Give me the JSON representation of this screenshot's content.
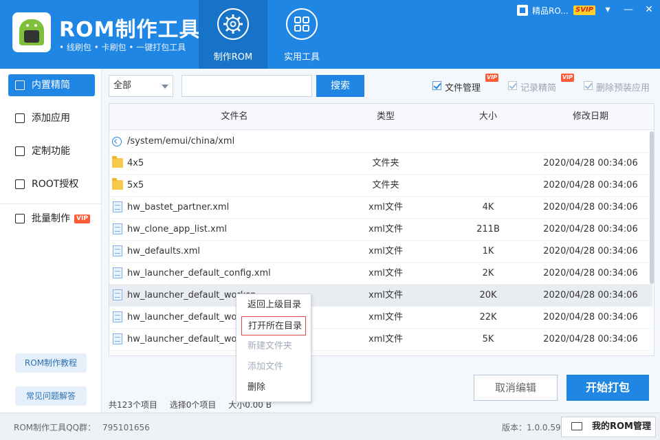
{
  "header": {
    "app_title": "ROM制作工具",
    "app_subtitle": "• 线刷包  • 卡刷包  • 一键打包工具",
    "tabs": [
      {
        "label": "制作ROM",
        "icon": "gear-icon",
        "active": true
      },
      {
        "label": "实用工具",
        "icon": "grid-icon",
        "active": false
      }
    ],
    "user_name": "精品RO...",
    "user_badge": "SVIP",
    "window_controls": {
      "dropdown": "▾",
      "minimize": "—",
      "close": "✕"
    }
  },
  "sidebar": {
    "items": [
      {
        "label": "内置精简",
        "icon": "export-icon",
        "active": true
      },
      {
        "label": "添加应用",
        "icon": "plus-box-icon",
        "active": false
      },
      {
        "label": "定制功能",
        "icon": "document-edit-icon",
        "active": false
      },
      {
        "label": "ROOT授权",
        "icon": "lock-icon",
        "active": false
      },
      {
        "label": "批量制作",
        "icon": "batch-icon",
        "active": false,
        "badge": "VIP"
      }
    ],
    "links": [
      "ROM制作教程",
      "常见问题解答"
    ]
  },
  "toolbar": {
    "filter_select": "全部",
    "search_value": "",
    "search_button": "搜索",
    "checkboxes": [
      {
        "label": "文件管理",
        "checked": true,
        "enabled": true,
        "vip": "VIP"
      },
      {
        "label": "记录精简",
        "checked": true,
        "enabled": false,
        "vip": "VIP"
      },
      {
        "label": "删除预装应用",
        "checked": true,
        "enabled": false
      }
    ]
  },
  "table": {
    "columns": [
      "文件名",
      "类型",
      "大小",
      "修改日期"
    ],
    "path": "/system/emui/china/xml",
    "rows": [
      {
        "name": "4x5",
        "type": "文件夹",
        "size": "",
        "date": "2020/04/28 00:34:06",
        "kind": "folder"
      },
      {
        "name": "5x5",
        "type": "文件夹",
        "size": "",
        "date": "2020/04/28 00:34:06",
        "kind": "folder"
      },
      {
        "name": "hw_bastet_partner.xml",
        "type": "xml文件",
        "size": "4K",
        "date": "2020/04/28 00:34:06",
        "kind": "file"
      },
      {
        "name": "hw_clone_app_list.xml",
        "type": "xml文件",
        "size": "211B",
        "date": "2020/04/28 00:34:06",
        "kind": "file"
      },
      {
        "name": "hw_defaults.xml",
        "type": "xml文件",
        "size": "1K",
        "date": "2020/04/28 00:34:06",
        "kind": "file"
      },
      {
        "name": "hw_launcher_default_config.xml",
        "type": "xml文件",
        "size": "2K",
        "date": "2020/04/28 00:34:06",
        "kind": "file"
      },
      {
        "name": "hw_launcher_default_worksp",
        "type": "xml文件",
        "size": "20K",
        "date": "2020/04/28 00:34:06",
        "kind": "file",
        "hover": true
      },
      {
        "name": "hw_launcher_default_worksp",
        "type": "xml文件",
        "size": "22K",
        "date": "2020/04/28 00:34:06",
        "kind": "file"
      },
      {
        "name": "hw_launcher_default_worksp",
        "type": "xml文件",
        "size": "5K",
        "date": "2020/04/28 00:34:06",
        "kind": "file"
      }
    ]
  },
  "context_menu": {
    "items": [
      {
        "label": "返回上级目录",
        "enabled": true
      },
      {
        "label": "打开所在目录",
        "enabled": true,
        "highlighted": true
      },
      {
        "label": "新建文件夹",
        "enabled": false
      },
      {
        "label": "添加文件",
        "enabled": false
      },
      {
        "label": "删除",
        "enabled": true
      }
    ]
  },
  "status": {
    "total": "共123个项目",
    "selected": "选择0个项目",
    "size": "大小0.00 B"
  },
  "actions": {
    "cancel": "取消编辑",
    "start": "开始打包"
  },
  "footer": {
    "qq_label": "ROM制作工具QQ群：",
    "qq_number": "795101656",
    "version": "版本：1.0.0.59",
    "rom_mgmt": "我的ROM管理"
  },
  "colors": {
    "primary": "#1f86e3",
    "active_tab": "#1673c7",
    "vip": "#ff5a36",
    "svip": "#ffcf2b"
  }
}
